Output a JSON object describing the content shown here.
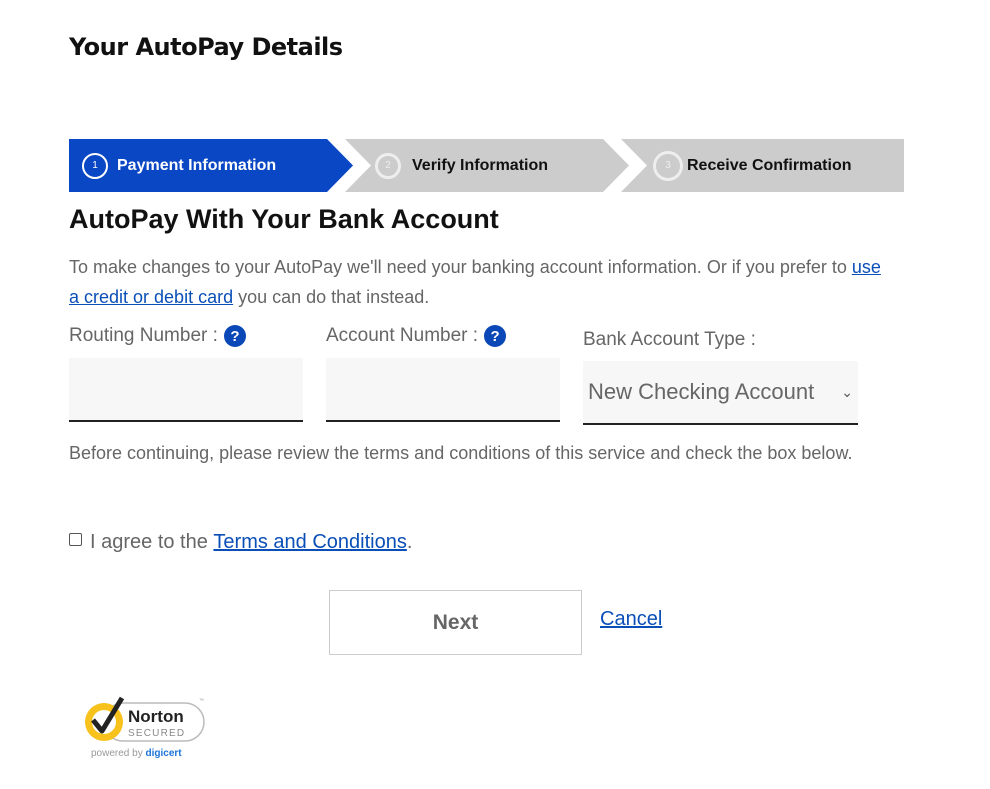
{
  "page": {
    "title": "Your AutoPay Details"
  },
  "stepper": {
    "steps": [
      {
        "number": "1",
        "label": "Payment Information",
        "state": "active"
      },
      {
        "number": "2",
        "label": "Verify Information",
        "state": "inactive"
      },
      {
        "number": "3",
        "label": "Receive Confirmation",
        "state": "inactive"
      }
    ],
    "colors": {
      "active": "#0a47c4",
      "inactive": "#cccccc"
    }
  },
  "section": {
    "title": "AutoPay With Your Bank Account",
    "intro_before": "To make changes to your AutoPay we'll need your banking account information. Or if you prefer to ",
    "intro_link": "use a credit or debit card",
    "intro_after": " you can do that instead."
  },
  "form": {
    "routing": {
      "label": "Routing Number :",
      "value": "",
      "help_icon": "question-circle-icon"
    },
    "account": {
      "label": "Account Number :",
      "value": "",
      "help_icon": "question-circle-icon"
    },
    "account_type": {
      "label": "Bank Account Type :",
      "selected": "New Checking Account"
    }
  },
  "terms": {
    "review_text": "Before continuing, please review the terms and conditions of this service and check the box below.",
    "agree_before": "I agree to the ",
    "agree_link": "Terms and Conditions",
    "agree_after": ".",
    "checked": false
  },
  "actions": {
    "next_label": "Next",
    "cancel_label": "Cancel"
  },
  "badge": {
    "brand": "Norton",
    "secured": "SECURED",
    "tm": "™",
    "powered_by": "powered by ",
    "powered_brand": "digicert",
    "powered_reg": "®"
  }
}
